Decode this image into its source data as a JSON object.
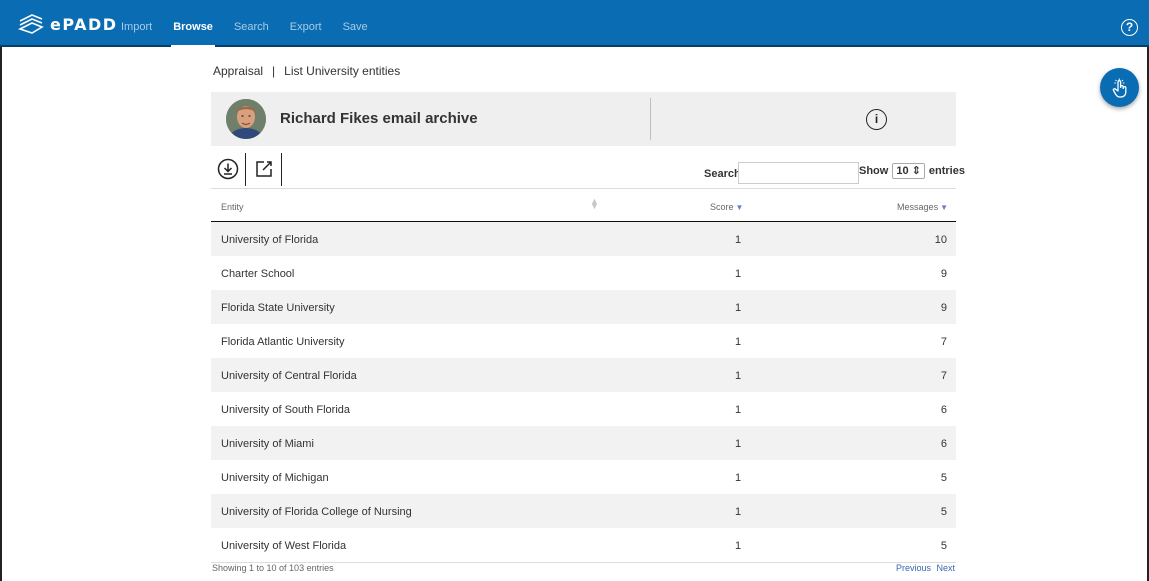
{
  "app": {
    "logo_text": "ePADD"
  },
  "nav": {
    "items": [
      {
        "label": "Import",
        "active": false
      },
      {
        "label": "Browse",
        "active": true
      },
      {
        "label": "Search",
        "active": false
      },
      {
        "label": "Export",
        "active": false
      },
      {
        "label": "Save",
        "active": false
      }
    ]
  },
  "breadcrumb": {
    "section": "Appraisal",
    "separator": "|",
    "page": "List University entities"
  },
  "archive": {
    "title": "Richard Fikes email archive"
  },
  "toolbar": {
    "search_label": "Search:",
    "search_value": "",
    "show_label": "Show",
    "show_value": "10",
    "entries_label": "entries"
  },
  "table": {
    "columns": [
      "Entity",
      "Score",
      "Messages"
    ],
    "rows": [
      {
        "entity": "University of Florida",
        "score": "1",
        "messages": "10"
      },
      {
        "entity": "Charter School",
        "score": "1",
        "messages": "9"
      },
      {
        "entity": "Florida State University",
        "score": "1",
        "messages": "9"
      },
      {
        "entity": "Florida Atlantic University",
        "score": "1",
        "messages": "7"
      },
      {
        "entity": "University of Central Florida",
        "score": "1",
        "messages": "7"
      },
      {
        "entity": "University of South Florida",
        "score": "1",
        "messages": "6"
      },
      {
        "entity": "University of Miami",
        "score": "1",
        "messages": "6"
      },
      {
        "entity": "University of Michigan",
        "score": "1",
        "messages": "5"
      },
      {
        "entity": "University of Florida College of Nursing",
        "score": "1",
        "messages": "5"
      },
      {
        "entity": "University of West Florida",
        "score": "1",
        "messages": "5"
      }
    ]
  },
  "footer": {
    "info": "Showing 1 to 10 of 103 entries",
    "previous": "Previous",
    "next": "Next"
  },
  "colors": {
    "brand": "#0a6db3",
    "link": "#3a66b5",
    "row_stripe": "#f2f2f2"
  },
  "icons": [
    "epadd-logo-icon",
    "help-icon",
    "touch-icon",
    "info-icon",
    "download-icon",
    "edit-icon",
    "sort-icon",
    "sort-desc-icon"
  ]
}
